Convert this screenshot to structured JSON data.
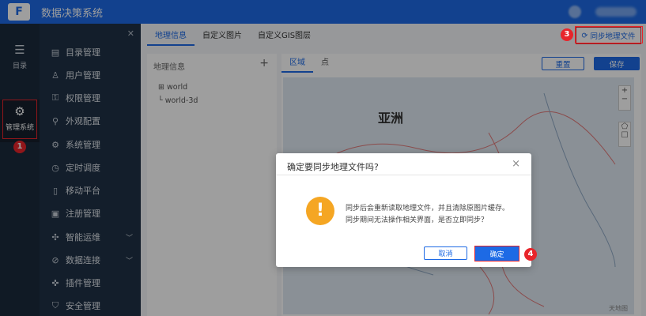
{
  "app": {
    "title": "数据决策系统",
    "logo": "F"
  },
  "rail": {
    "catalog": {
      "label": "目录",
      "icon": "list-icon"
    },
    "mgmt": {
      "label": "管理系统",
      "icon": "gear-icon"
    }
  },
  "badges": {
    "b1": "1",
    "b3": "3",
    "b4": "4"
  },
  "menu": {
    "items": [
      {
        "label": "目录管理",
        "icon": "▤"
      },
      {
        "label": "用户管理",
        "icon": "♙"
      },
      {
        "label": "权限管理",
        "icon": "⚿"
      },
      {
        "label": "外观配置",
        "icon": "⚲"
      },
      {
        "label": "系统管理",
        "icon": "⚙"
      },
      {
        "label": "定时调度",
        "icon": "◷"
      },
      {
        "label": "移动平台",
        "icon": "▯"
      },
      {
        "label": "注册管理",
        "icon": "▣"
      },
      {
        "label": "智能运维",
        "icon": "✣",
        "chevron": "﹀"
      },
      {
        "label": "数据连接",
        "icon": "⊘",
        "chevron": "﹀"
      },
      {
        "label": "插件管理",
        "icon": "✜"
      },
      {
        "label": "安全管理",
        "icon": "⛉"
      }
    ]
  },
  "tabs": [
    {
      "label": "地理信息"
    },
    {
      "label": "自定义图片"
    },
    {
      "label": "自定义GIS图层"
    }
  ],
  "sync_button": {
    "icon": "⟳",
    "label": "同步地理文件"
  },
  "geo_panel": {
    "title": "地理信息",
    "add": "+",
    "tree": [
      {
        "label": "world",
        "prefix": "⊞"
      },
      {
        "label": "world-3d",
        "prefix": "└"
      }
    ]
  },
  "sub_tabs": [
    {
      "label": "区域"
    },
    {
      "label": "点"
    }
  ],
  "actions": {
    "reset": "重置",
    "save": "保存"
  },
  "map": {
    "region_label": "亚洲",
    "attrib": "天地图"
  },
  "dialog": {
    "title": "确定要同步地理文件吗?",
    "close": "×",
    "line1": "同步后会重新读取地理文件，并且清除原图片缓存。",
    "line2": "同步期间无法操作相关界面，是否立即同步？",
    "cancel": "取消",
    "confirm": "确定",
    "icon": "!"
  }
}
